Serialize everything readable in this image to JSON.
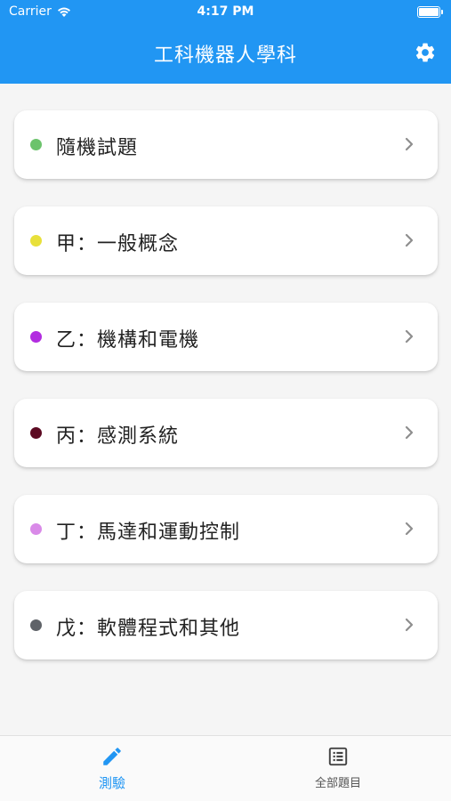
{
  "status_bar": {
    "carrier": "Carrier",
    "time": "4:17 PM"
  },
  "header": {
    "title": "工科機器人學科",
    "settings_icon": "gear-icon"
  },
  "colors": {
    "accent": "#2196f3"
  },
  "list": [
    {
      "label": "隨機試題",
      "color": "#6cc36c"
    },
    {
      "label": "甲：一般概念",
      "color": "#e8e03a"
    },
    {
      "label": "乙：機構和電機",
      "color": "#b22ce0"
    },
    {
      "label": "丙：感測系統",
      "color": "#5c0a22"
    },
    {
      "label": "丁：馬達和運動控制",
      "color": "#d98ae8"
    },
    {
      "label": "戊：軟體程式和其他",
      "color": "#5f6368"
    }
  ],
  "tabs": [
    {
      "label": "測驗",
      "icon": "pencil-icon",
      "active": true
    },
    {
      "label": "全部題目",
      "icon": "list-icon",
      "active": false
    }
  ]
}
